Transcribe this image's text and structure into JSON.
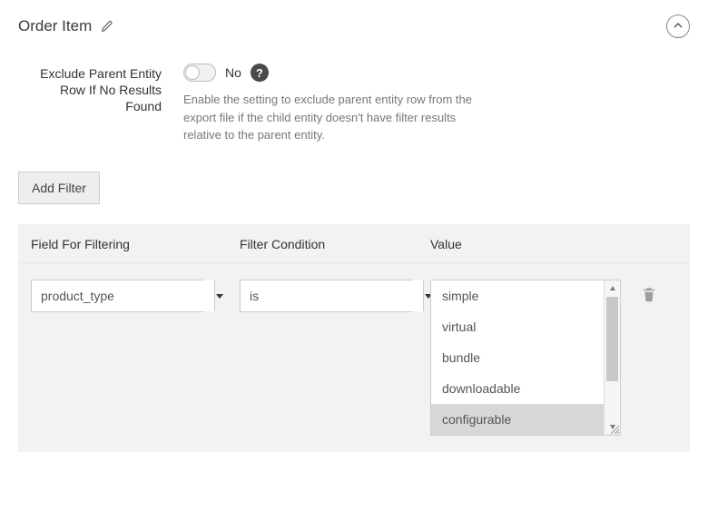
{
  "section": {
    "title": "Order Item"
  },
  "exclude": {
    "label": "Exclude Parent Entity Row If No Results Found",
    "value": "No",
    "description": "Enable the setting to exclude parent entity row from the export file if the child entity doesn't have filter results relative to the parent entity."
  },
  "buttons": {
    "add_filter": "Add Filter"
  },
  "table": {
    "headers": {
      "field": "Field For Filtering",
      "condition": "Filter Condition",
      "value": "Value"
    },
    "rows": [
      {
        "field": "product_type",
        "condition": "is",
        "options": [
          "simple",
          "virtual",
          "bundle",
          "downloadable",
          "configurable"
        ],
        "selected": "configurable"
      }
    ]
  }
}
